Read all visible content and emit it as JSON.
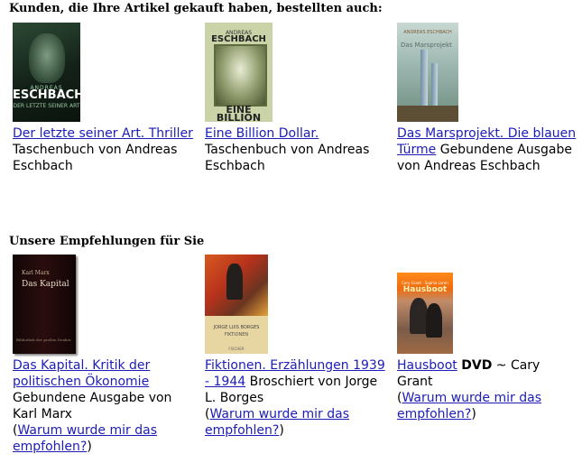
{
  "sections": [
    {
      "title": "Kunden, die Ihre Artikel gekauft haben, bestellten auch:",
      "items": [
        {
          "link": "Der letzte seiner Art. Thriller",
          "desc": "Taschenbuch von Andreas Eschbach",
          "cover": {
            "author": "ANDREAS",
            "name": "ESCHBACH",
            "subtitle": "DER LETZTE SEINER ART"
          }
        },
        {
          "link": "Eine Billion Dollar.",
          "desc": "Taschenbuch von Andreas Eschbach",
          "cover": {
            "author": "ANDREAS",
            "name": "ESCHBACH",
            "subtitle": "EINE BILLION DOLLAR"
          }
        },
        {
          "link": "Das Marsprojekt. Die blauen Türme",
          "desc": "Gebundene Ausgabe von Andreas Eschbach",
          "cover": {
            "author": "ANDREAS ESCHBACH",
            "name": "Das Marsprojekt",
            "subtitle": ""
          }
        }
      ]
    },
    {
      "title": "Unsere Empfehlungen für Sie",
      "items": [
        {
          "link": "Das Kapital. Kritik der politischen Ökonomie",
          "desc": "Gebundene Ausgabe von Karl Marx",
          "why_open": "(",
          "why": "Warum wurde mir das empfohlen?",
          "why_close": ")",
          "cover": {
            "author": "Karl Marx",
            "name": "Das Kapital",
            "subtitle": "Bibliothek der großen Denker"
          }
        },
        {
          "link": "Fiktionen. Erzählungen 1939 - 1944",
          "desc": "Broschiert von Jorge L. Borges",
          "why_open": "(",
          "why": "Warum wurde mir das empfohlen?",
          "why_close": ")",
          "cover": {
            "author": "JORGE LUIS BORGES",
            "name": "FIKTIONEN",
            "subtitle": "FISCHER"
          }
        },
        {
          "link": "Hausboot",
          "format": "DVD",
          "desc": "~ Cary Grant",
          "why_open": "(",
          "why": "Warum wurde mir das empfohlen?",
          "why_close": ")",
          "cover": {
            "author": "Cary Grant · Sophia Loren",
            "name": "Hausboot",
            "subtitle": ""
          }
        }
      ]
    }
  ],
  "colors": {
    "link": "#1c1cb8",
    "text": "#000000",
    "background": "#ffffff"
  }
}
